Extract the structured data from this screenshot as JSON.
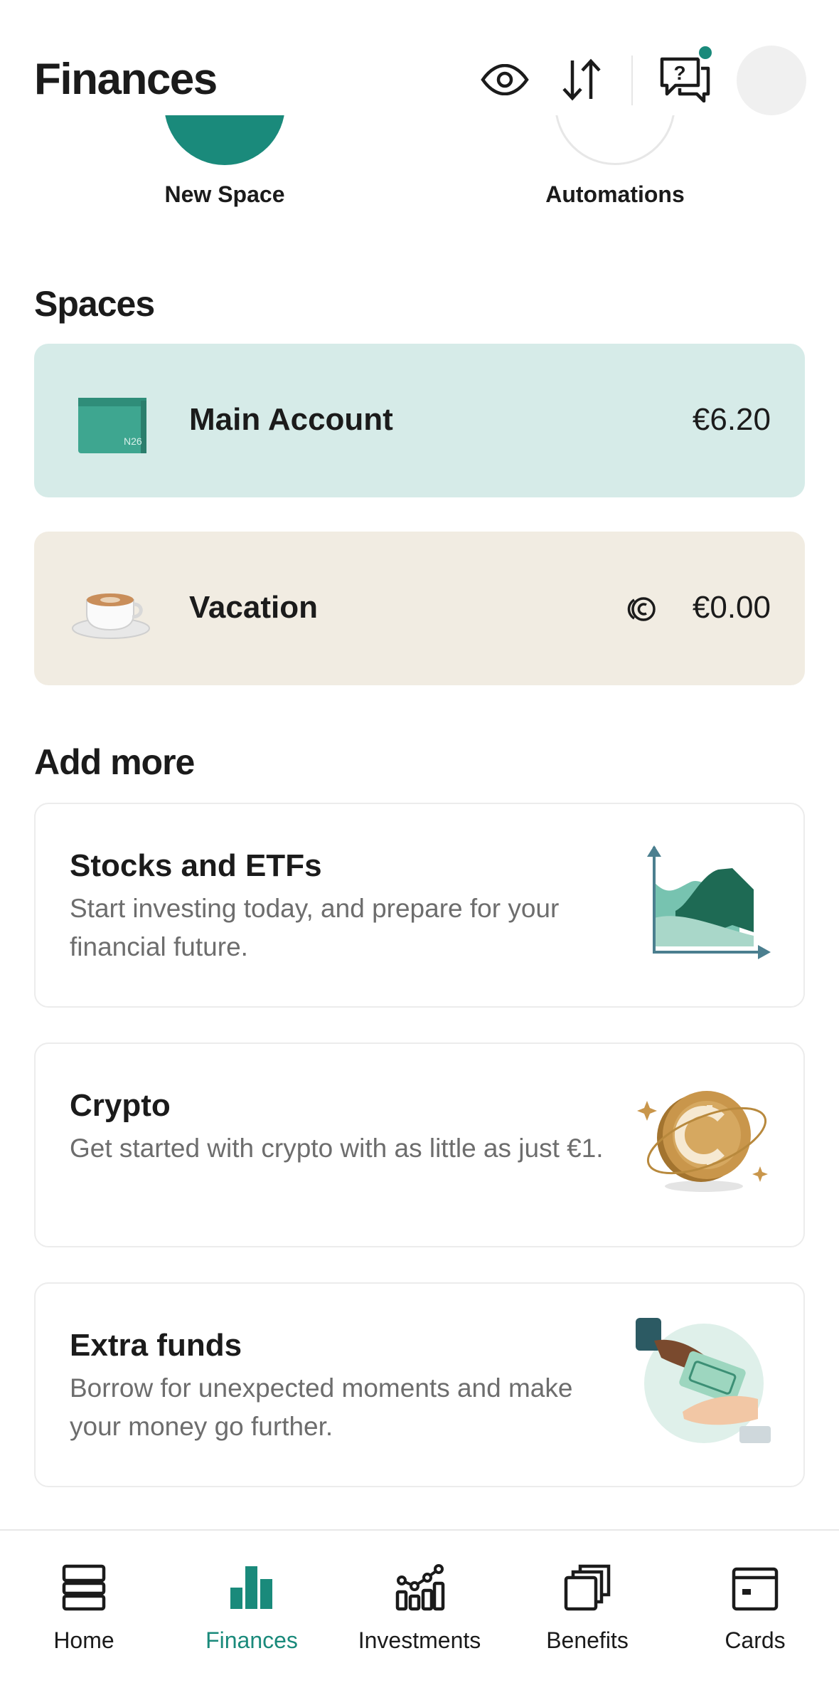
{
  "header": {
    "title": "Finances",
    "icons": [
      "eye-icon",
      "sort-arrows-icon",
      "help-chat-icon"
    ],
    "has_notification": true
  },
  "quick_actions": [
    {
      "label": "New Space"
    },
    {
      "label": "Automations"
    }
  ],
  "spaces": {
    "title": "Spaces",
    "items": [
      {
        "name": "Main Account",
        "amount": "€6.20",
        "color": "#d6ebe8",
        "icon": "n26-wallet-icon"
      },
      {
        "name": "Vacation",
        "amount": "€0.00",
        "color": "#f1ece2",
        "icon": "coffee-cup-icon",
        "badge_icon": "shared-coins-icon"
      }
    ]
  },
  "add_more": {
    "title": "Add more",
    "items": [
      {
        "title": "Stocks and ETFs",
        "description": "Start investing today, and prepare for your financial future.",
        "icon": "growth-chart-icon"
      },
      {
        "title": "Crypto",
        "description": "Get started with crypto with as little as just €1.",
        "icon": "crypto-coin-icon"
      },
      {
        "title": "Extra funds",
        "description": "Borrow for unexpected moments and make your money go further.",
        "icon": "hands-money-icon"
      }
    ]
  },
  "bottom_nav": {
    "items": [
      {
        "label": "Home",
        "icon": "home-icon"
      },
      {
        "label": "Finances",
        "icon": "finances-bars-icon",
        "active": true
      },
      {
        "label": "Investments",
        "icon": "investments-icon"
      },
      {
        "label": "Benefits",
        "icon": "benefits-icon"
      },
      {
        "label": "Cards",
        "icon": "cards-icon"
      }
    ]
  },
  "colors": {
    "accent": "#1a8a7b",
    "main_account_bg": "#d6ebe8",
    "vacation_bg": "#f1ece2",
    "muted_text": "#6d6d6d"
  }
}
